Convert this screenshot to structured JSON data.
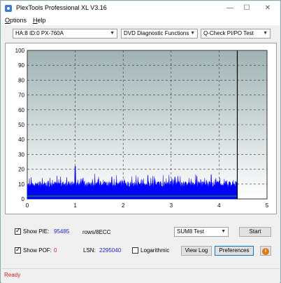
{
  "window": {
    "title": "PlexTools Professional XL V3.16",
    "controls": {
      "minimize": "—",
      "maximize": "☐",
      "close": "✕"
    }
  },
  "menu": {
    "items": [
      {
        "label": "Options",
        "hotkey": "O",
        "rest": "ptions"
      },
      {
        "label": "Help",
        "hotkey": "H",
        "rest": "elp"
      }
    ]
  },
  "toolbar": {
    "drive": "HA:8 ID:0  PX-760A",
    "function": "DVD Diagnostic Functions",
    "test": "Q-Check PI/PO Test"
  },
  "chart_data": {
    "type": "area",
    "x_range": [
      0,
      5
    ],
    "y_range": [
      0,
      100
    ],
    "x_ticks": [
      "0",
      "1",
      "2",
      "3",
      "4",
      "5"
    ],
    "y_ticks": [
      "0",
      "10",
      "20",
      "30",
      "40",
      "50",
      "60",
      "70",
      "80",
      "90",
      "100"
    ],
    "grid": true,
    "end_marker_x": 4.38,
    "series": [
      {
        "color": "#0000ff",
        "mean_level": 10,
        "peak_level": 22
      }
    ],
    "bottom_line": {
      "color": "#00c000",
      "level": 0.5
    },
    "colors": {
      "bg_top": "#9fb3b3",
      "bg_bottom": "#ffffff",
      "fill": "#0000ff",
      "spike": "#0000ff"
    }
  },
  "pie": {
    "checkbox_label": "Show PIE:",
    "value": "95485",
    "unit": "rows/8ECC"
  },
  "pof": {
    "checkbox_label": "Show POF:",
    "value": "0",
    "lsn_label": "LSN:",
    "lsn_value": "2295040"
  },
  "controls": {
    "mode": "SUM8 Test",
    "start_label": "Start",
    "log_label": "Logarithmic",
    "view_log_label": "View Log",
    "preferences_label": "Preferences",
    "info_icon": "i"
  },
  "status": {
    "text": "Ready"
  }
}
